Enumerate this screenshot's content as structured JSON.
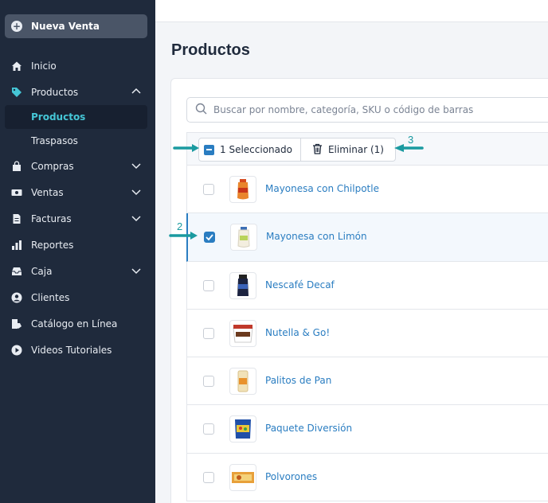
{
  "sidebar": {
    "new_sale": "Nueva Venta",
    "items": [
      {
        "label": "Inicio",
        "icon": "home-icon"
      },
      {
        "label": "Productos",
        "icon": "tag-icon",
        "expanded": true
      },
      {
        "label": "Compras",
        "icon": "bag-icon"
      },
      {
        "label": "Ventas",
        "icon": "money-icon"
      },
      {
        "label": "Facturas",
        "icon": "invoice-icon"
      },
      {
        "label": "Reportes",
        "icon": "chart-icon"
      },
      {
        "label": "Caja",
        "icon": "inbox-icon"
      },
      {
        "label": "Clientes",
        "icon": "user-icon"
      },
      {
        "label": "Catálogo en Línea",
        "icon": "catalog-icon"
      },
      {
        "label": "Videos Tutoriales",
        "icon": "play-icon"
      }
    ],
    "sub_items": [
      {
        "label": "Productos",
        "active": true
      },
      {
        "label": "Traspasos",
        "active": false
      }
    ]
  },
  "main": {
    "title": "Productos",
    "search_placeholder": "Buscar por nombre, categoría, SKU o código de barras",
    "bulk": {
      "selected_label": "1 Seleccionado",
      "delete_label": "Eliminar (1)"
    },
    "products": [
      {
        "name": "Mayonesa con Chilpotle",
        "selected": false
      },
      {
        "name": "Mayonesa con Limón",
        "selected": true
      },
      {
        "name": "Nescafé Decaf",
        "selected": false
      },
      {
        "name": "Nutella & Go!",
        "selected": false
      },
      {
        "name": "Palitos de Pan",
        "selected": false
      },
      {
        "name": "Paquete Diversión",
        "selected": false
      },
      {
        "name": "Polvorones",
        "selected": false
      }
    ]
  },
  "annotations": {
    "marker_2": "2",
    "marker_3": "3"
  },
  "colors": {
    "sidebar_bg": "#1f2a3c",
    "accent": "#2a7dc1",
    "active_sub": "#45c6d6",
    "annotation": "#1a9aa0"
  }
}
